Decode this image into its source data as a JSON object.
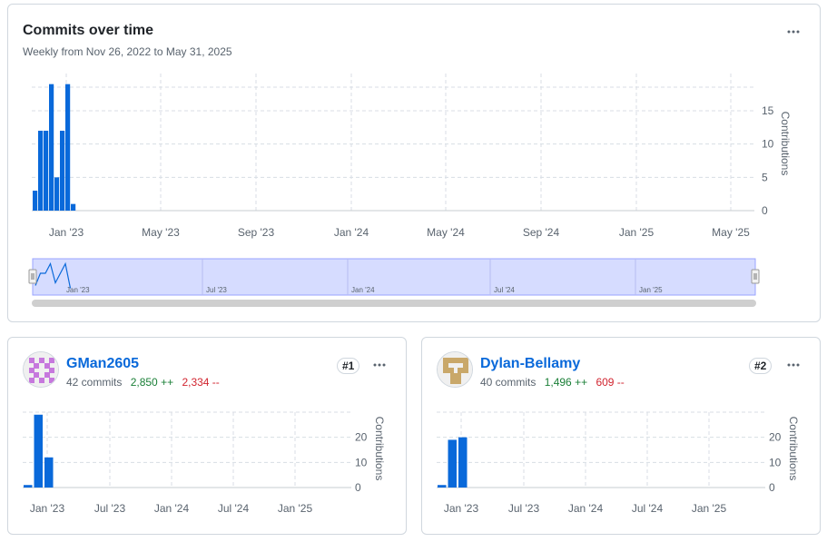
{
  "main": {
    "title": "Commits over time",
    "subtitle": "Weekly from Nov 26, 2022 to May 31, 2025",
    "menu_icon": "kebab-horizontal-icon",
    "chart_data": {
      "type": "bar",
      "ylabel": "Contributions",
      "xlabel": "",
      "x_range": [
        "2022-11-26",
        "2025-05-31"
      ],
      "ylim": [
        0,
        18
      ],
      "yticks": [
        "0",
        "5",
        "10",
        "15"
      ],
      "xticks": [
        "Jan '23",
        "May '23",
        "Sep '23",
        "Jan '24",
        "May '24",
        "Sep '24",
        "Jan '25",
        "May '25"
      ],
      "grid": true,
      "weeks": [
        "2022-11-27",
        "2022-12-04",
        "2022-12-11",
        "2022-12-18",
        "2022-12-25",
        "2023-01-01",
        "2023-01-08",
        "2023-01-15"
      ],
      "values": [
        3,
        12,
        12,
        19,
        5,
        12,
        19,
        1
      ]
    },
    "navigator": {
      "labels": [
        "Jan '23",
        "Jul '23",
        "Jan '24",
        "Jul '24",
        "Jan '25"
      ]
    }
  },
  "contributors": [
    {
      "username": "GMan2605",
      "commits": "42 commits",
      "additions": "2,850 ++",
      "deletions": "2,334 --",
      "rank": "#1",
      "avatar_icon": "identicon-avatar",
      "avatar_color": "#c678dd",
      "chart_data": {
        "type": "bar",
        "ylabel": "Contributions",
        "yticks": [
          "0",
          "10",
          "20"
        ],
        "ylim": [
          0,
          30
        ],
        "xticks": [
          "Jan '23",
          "Jul '23",
          "Jan '24",
          "Jul '24",
          "Jan '25"
        ],
        "grid": true,
        "values": [
          1,
          29,
          12
        ]
      }
    },
    {
      "username": "Dylan-Bellamy",
      "commits": "40 commits",
      "additions": "1,496 ++",
      "deletions": "609 --",
      "rank": "#2",
      "avatar_icon": "identicon-avatar",
      "avatar_color": "#c9a86a",
      "chart_data": {
        "type": "bar",
        "ylabel": "Contributions",
        "yticks": [
          "0",
          "10",
          "20"
        ],
        "ylim": [
          0,
          30
        ],
        "xticks": [
          "Jan '23",
          "Jul '23",
          "Jan '24",
          "Jul '24",
          "Jan '25"
        ],
        "grid": true,
        "values": [
          1,
          19,
          20
        ]
      }
    }
  ],
  "colors": {
    "bar": "#0969da",
    "grid": "#d8dee4",
    "navigator_fill": "#d6dcff",
    "scrollbar": "#cfcfcf"
  }
}
